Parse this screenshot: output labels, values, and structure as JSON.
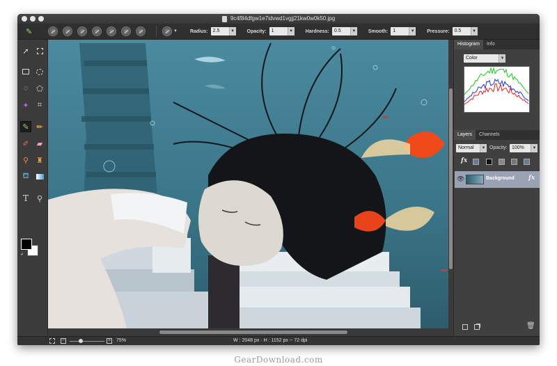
{
  "window": {
    "title": "9c4f84dfgw1e7idvwd1vgjj21kw0w0k50.jpg"
  },
  "options_bar": {
    "radius_label": "Radius:",
    "radius_value": "2.5",
    "opacity_label": "Opacity:",
    "opacity_value": "1",
    "hardness_label": "Hardness:",
    "hardness_value": "0.5",
    "smooth_label": "Smooth:",
    "smooth_value": "1",
    "pressure_label": "Pressure:",
    "pressure_value": "0.5"
  },
  "tools": {
    "text_tool_glyph": "T"
  },
  "histogram_panel": {
    "tabs": [
      "Histogram",
      "Info"
    ],
    "channel_select": "Color",
    "colors": {
      "red": "#e02020",
      "green": "#18c818",
      "blue": "#2030e0"
    }
  },
  "layers_panel": {
    "tabs": [
      "Layers",
      "Channels"
    ],
    "blend_mode": "Normal",
    "opacity_label": "Opacity:",
    "opacity_value": "100%",
    "fx_label": "fx",
    "layers": [
      {
        "name": "Background",
        "visible": true
      }
    ]
  },
  "status_bar": {
    "zoom": "75%",
    "image_info": "W : 2048 px  ·  H : 1152 px  --  72 dpi"
  },
  "watermark": "GearDownload.com"
}
